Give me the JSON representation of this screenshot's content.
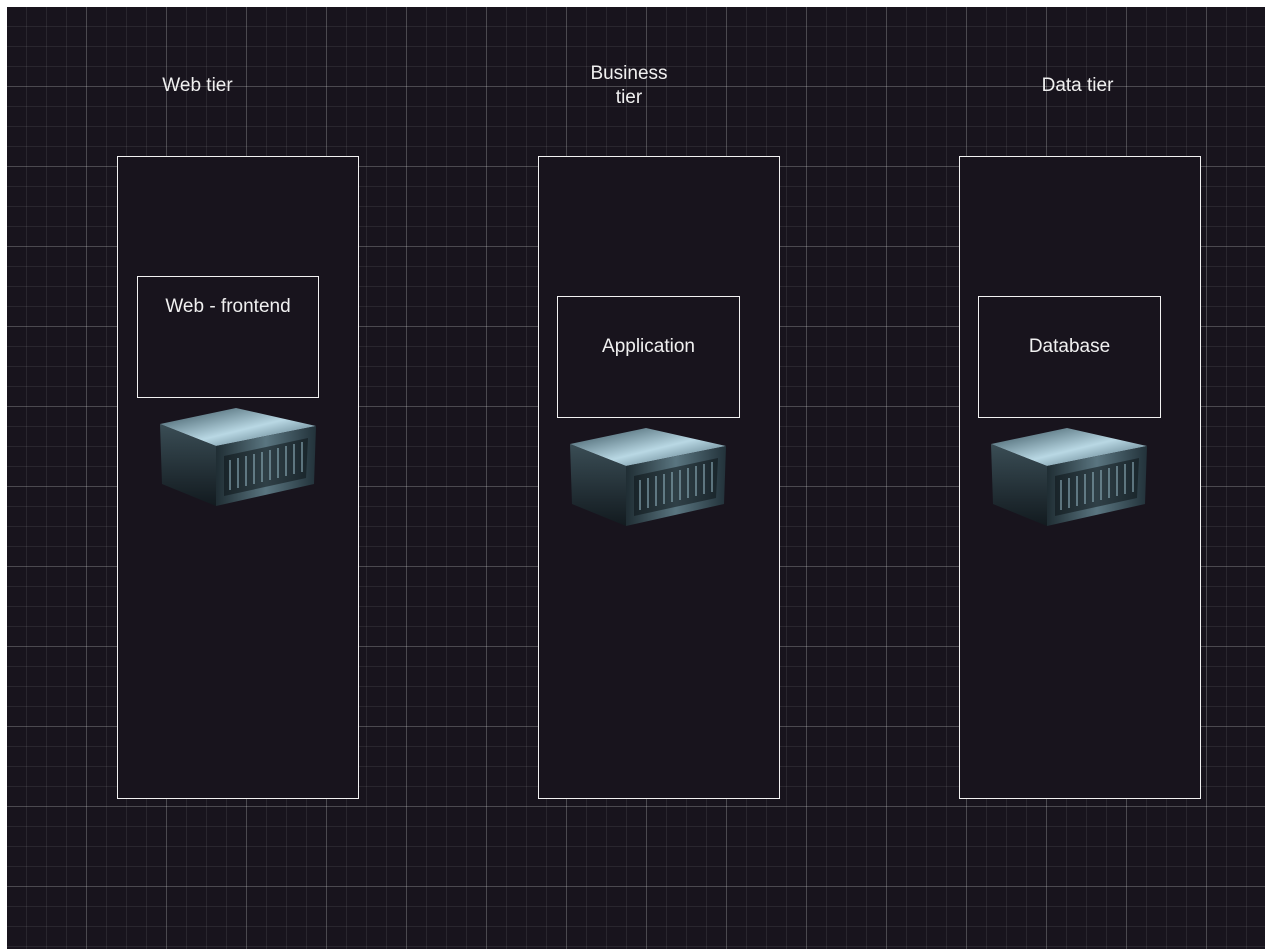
{
  "diagram": {
    "tiers": [
      {
        "label": "Web tier",
        "component": "Web - frontend",
        "icon": "server-icon"
      },
      {
        "label": "Business tier",
        "component": "Application",
        "icon": "server-icon"
      },
      {
        "label": "Data tier",
        "component": "Database",
        "icon": "server-icon"
      }
    ]
  },
  "colors": {
    "background": "#18141d",
    "stroke": "#f2f2f2",
    "text": "#f0f0f0"
  }
}
